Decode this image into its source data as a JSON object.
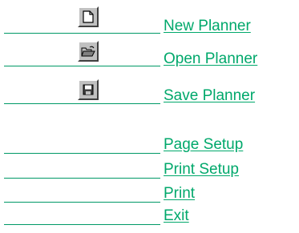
{
  "menu": {
    "file_items": [
      {
        "label": "New Planner",
        "icon": "new-document-icon"
      },
      {
        "label": "Open Planner",
        "icon": "open-folder-icon"
      },
      {
        "label": "Save Planner",
        "icon": "save-disk-icon"
      }
    ],
    "print_items": [
      {
        "label": "Page Setup"
      },
      {
        "label": "Print Setup"
      },
      {
        "label": "Print"
      },
      {
        "label": "Exit"
      }
    ]
  },
  "colors": {
    "link": "#00a86b",
    "underline": "#009966",
    "button_face": "#c0c0c0"
  }
}
